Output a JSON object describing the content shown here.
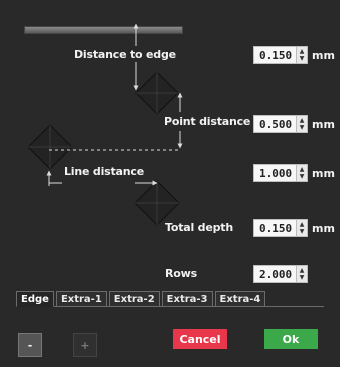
{
  "diagram": {
    "labels": {
      "distance_to_edge": "Distance to edge",
      "point_distance": "Point distance",
      "line_distance": "Line distance",
      "total_depth": "Total depth",
      "rows": "Rows"
    }
  },
  "fields": {
    "distance_to_edge": {
      "value": "0.150",
      "unit": "mm"
    },
    "point_distance": {
      "value": "0.500",
      "unit": "mm"
    },
    "line_distance": {
      "value": "1.000",
      "unit": "mm"
    },
    "total_depth": {
      "value": "0.150",
      "unit": "mm"
    },
    "rows": {
      "value": "2.000"
    }
  },
  "tabs": [
    "Edge",
    "Extra-1",
    "Extra-2",
    "Extra-3",
    "Extra-4"
  ],
  "buttons": {
    "minus": "-",
    "plus": "+",
    "cancel": "Cancel",
    "ok": "Ok"
  },
  "colors": {
    "background": "#292929",
    "cancel": "#e8374a",
    "ok": "#3ba84a",
    "diamond": "#232323"
  }
}
